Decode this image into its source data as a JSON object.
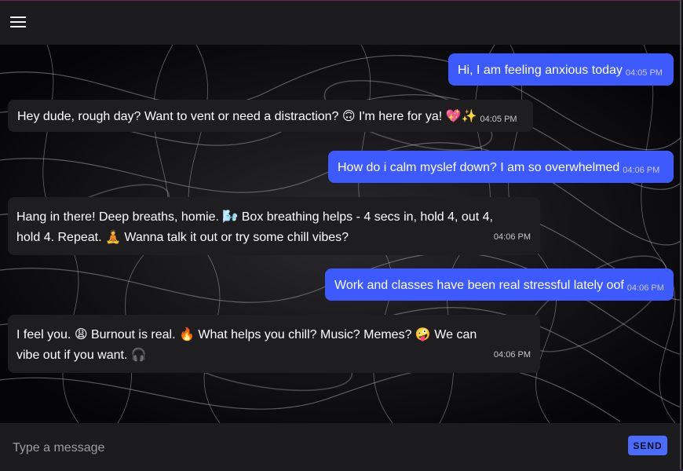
{
  "header": {
    "menu_icon": "hamburger-menu-icon"
  },
  "messages": [
    {
      "sender": "user",
      "text": "Hi, I am feeling anxious today",
      "time": "04:05 PM"
    },
    {
      "sender": "bot",
      "text": "Hey dude, rough day? Want to vent or need a distraction? 🙃 I'm here for ya! 💖✨",
      "time": "04:05 PM"
    },
    {
      "sender": "user",
      "text": "How do i calm myslef down? I am so overwhelmed",
      "time": "04:06 PM"
    },
    {
      "sender": "bot",
      "text": "Hang in there! Deep breaths, homie. 🌬️ Box breathing helps - 4 secs in, hold 4, out 4, hold 4. Repeat. 🧘 Wanna talk it out or try some chill vibes?",
      "time": "04:06 PM"
    },
    {
      "sender": "user",
      "text": "Work and classes have been real stressful lately oof",
      "time": "04:06 PM"
    },
    {
      "sender": "bot",
      "text": "I feel you. 😩 Burnout is real. 🔥 What helps you chill? Music? Memes? 🤪 We can vibe out if you want. 🎧",
      "time": "04:06 PM"
    }
  ],
  "composer": {
    "placeholder": "Type a message",
    "value": "",
    "send_label": "SEND"
  },
  "colors": {
    "user_bubble": "#3d5afe",
    "bot_bubble": "#1e1e20",
    "send_button": "#4b6bfb",
    "header": "#1c1c1e"
  }
}
